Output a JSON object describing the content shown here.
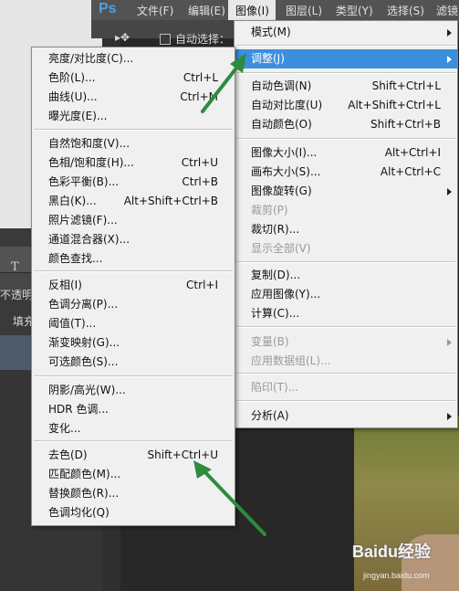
{
  "app": {
    "logo": "Ps"
  },
  "menubar": [
    "文件(F)",
    "编辑(E)",
    "图像(I)",
    "图层(L)",
    "类型(Y)",
    "选择(S)",
    "滤镜"
  ],
  "optionsbar": {
    "auto_select_label": "自动选择："
  },
  "left_panel": {
    "type_icon": "T",
    "opacity_label": "不透明度",
    "fill_label": "填充"
  },
  "image_menu": [
    {
      "label": "模式(M)",
      "submenu": true
    },
    {
      "label": "调整(J)",
      "submenu": true,
      "highlighted": true
    },
    {
      "label": "自动色调(N)",
      "shortcut": "Shift+Ctrl+L"
    },
    {
      "label": "自动对比度(U)",
      "shortcut": "Alt+Shift+Ctrl+L"
    },
    {
      "label": "自动颜色(O)",
      "shortcut": "Shift+Ctrl+B"
    },
    {
      "label": "图像大小(I)...",
      "shortcut": "Alt+Ctrl+I"
    },
    {
      "label": "画布大小(S)...",
      "shortcut": "Alt+Ctrl+C"
    },
    {
      "label": "图像旋转(G)",
      "submenu": true
    },
    {
      "label": "裁剪(P)",
      "disabled": true
    },
    {
      "label": "裁切(R)..."
    },
    {
      "label": "显示全部(V)",
      "disabled": true
    },
    {
      "label": "复制(D)..."
    },
    {
      "label": "应用图像(Y)..."
    },
    {
      "label": "计算(C)..."
    },
    {
      "label": "变量(B)",
      "submenu": true,
      "disabled": true
    },
    {
      "label": "应用数据组(L)...",
      "disabled": true
    },
    {
      "label": "陷印(T)...",
      "disabled": true
    },
    {
      "label": "分析(A)",
      "submenu": true
    }
  ],
  "adjust_menu": [
    {
      "label": "亮度/对比度(C)..."
    },
    {
      "label": "色阶(L)...",
      "shortcut": "Ctrl+L"
    },
    {
      "label": "曲线(U)...",
      "shortcut": "Ctrl+M"
    },
    {
      "label": "曝光度(E)..."
    },
    {
      "label": "自然饱和度(V)..."
    },
    {
      "label": "色相/饱和度(H)...",
      "shortcut": "Ctrl+U"
    },
    {
      "label": "色彩平衡(B)...",
      "shortcut": "Ctrl+B"
    },
    {
      "label": "黑白(K)...",
      "shortcut": "Alt+Shift+Ctrl+B"
    },
    {
      "label": "照片滤镜(F)..."
    },
    {
      "label": "通道混合器(X)..."
    },
    {
      "label": "颜色查找..."
    },
    {
      "label": "反相(I)",
      "shortcut": "Ctrl+I"
    },
    {
      "label": "色调分离(P)..."
    },
    {
      "label": "阈值(T)..."
    },
    {
      "label": "渐变映射(G)..."
    },
    {
      "label": "可选颜色(S)..."
    },
    {
      "label": "阴影/高光(W)..."
    },
    {
      "label": "HDR 色调..."
    },
    {
      "label": "变化..."
    },
    {
      "label": "去色(D)",
      "shortcut": "Shift+Ctrl+U"
    },
    {
      "label": "匹配颜色(M)..."
    },
    {
      "label": "替换颜色(R)..."
    },
    {
      "label": "色调均化(Q)"
    }
  ],
  "watermark": {
    "text": "Baidu经验",
    "url": "jingyan.baidu.com"
  },
  "colors": {
    "highlight": "#3b8fdc",
    "annotation_arrow": "#2e8b3e",
    "ps_logo": "#4ea0e6"
  }
}
